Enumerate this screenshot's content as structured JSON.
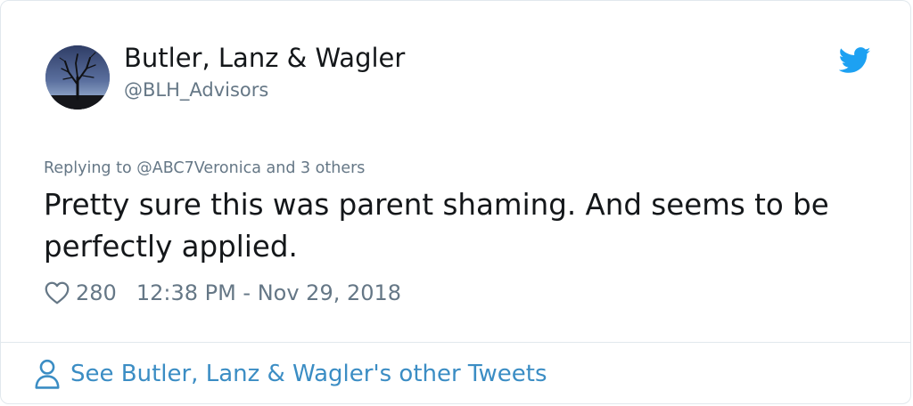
{
  "author": {
    "display_name": "Butler, Lanz & Wagler",
    "handle": "@BLH_Advisors",
    "avatar_icon": "avatar-tree-silhouette"
  },
  "brand": {
    "icon": "twitter-bird-icon",
    "color": "#1da1f2"
  },
  "tweet": {
    "replying_to": "Replying to @ABC7Veronica and 3 others",
    "text": "Pretty sure this was parent shaming. And seems to be perfectly applied.",
    "likes": "280",
    "timestamp": "12:38 PM - Nov 29, 2018"
  },
  "footer": {
    "link_label": "See Butler, Lanz & Wagler's other Tweets",
    "icon": "person-icon",
    "link_color": "#3b8dc4"
  }
}
